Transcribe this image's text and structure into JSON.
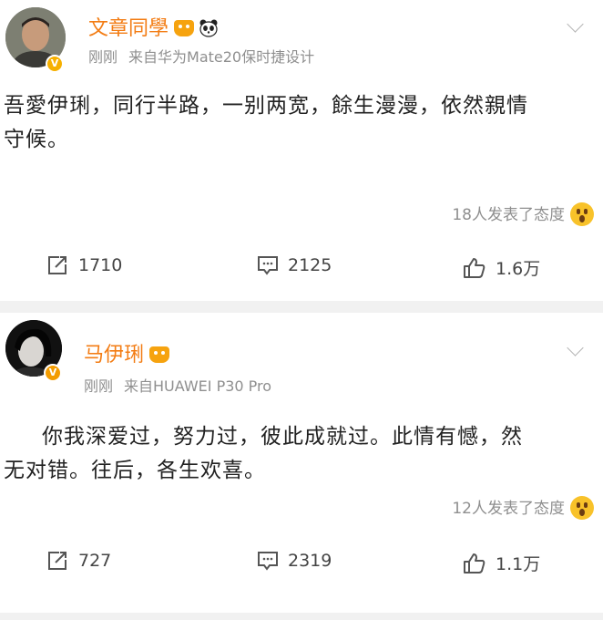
{
  "posts": [
    {
      "author": "文章同學",
      "time": "刚刚",
      "source": "来自华为Mate20保时捷设计",
      "text_lines": [
        "吾愛伊琍，同行半路，一别两宽，餘生漫漫，依然親情",
        "守候。"
      ],
      "reactions": "18人发表了态度",
      "reposts": "1710",
      "comments": "2125",
      "likes": "1.6万"
    },
    {
      "author": "马伊琍",
      "time": "刚刚",
      "source": "来自HUAWEI P30 Pro",
      "text_lines": [
        "你我深爱过，努力过，彼此成就过。此情有憾，然",
        "无对错。往后，各生欢喜。"
      ],
      "reactions": "12人发表了态度",
      "reposts": "727",
      "comments": "2319",
      "likes": "1.1万"
    }
  ],
  "colors": {
    "name": "#f37c13",
    "badge": "#f6b000",
    "meta": "#8f8f8f"
  },
  "icons": [
    "crown-badge-icon",
    "panda-icon",
    "chevron-down-icon",
    "wow-emoji-icon",
    "repost-icon",
    "comment-icon",
    "like-icon"
  ]
}
